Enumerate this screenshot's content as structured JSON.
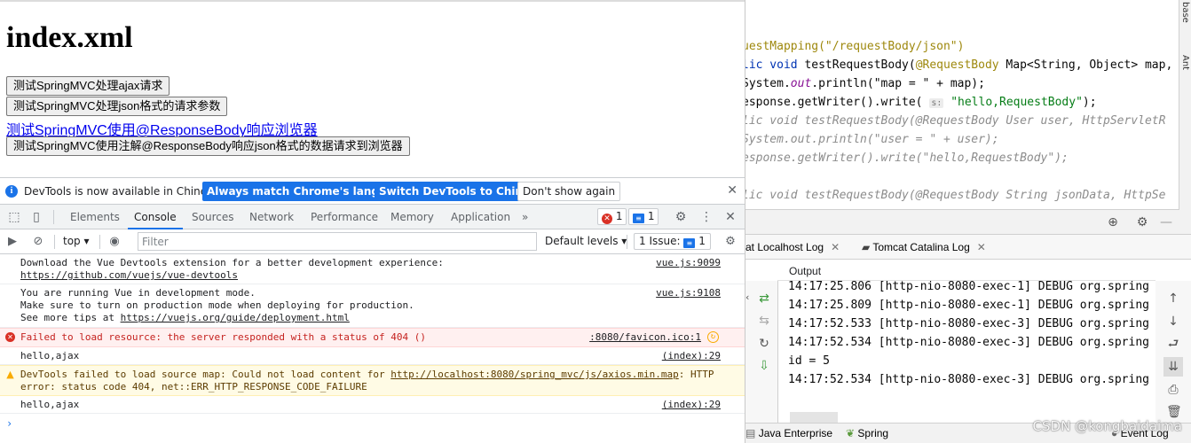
{
  "page": {
    "title": "index.xml",
    "btn_ajax": "测试SpringMVC处理ajax请求",
    "btn_json": "测试SpringMVC处理json格式的请求参数",
    "link_responsebody": "测试SpringMVC使用@ResponseBody响应浏览器",
    "btn_responsebody_json": "测试SpringMVC使用注解@ResponseBody响应json格式的数据请求到浏览器"
  },
  "devtools": {
    "infobar": {
      "message": "DevTools is now available in Chinese!",
      "btn_match": "Always match Chrome's language",
      "btn_switch": "Switch DevTools to Chinese",
      "btn_dont_show": "Don't show again"
    },
    "tabs": [
      "Elements",
      "Console",
      "Sources",
      "Network",
      "Performance",
      "Memory",
      "Application"
    ],
    "active_tab": "Console",
    "error_count": "1",
    "message_count": "1",
    "context": "top",
    "filter_placeholder": "Filter",
    "levels": "Default levels",
    "issues": "1 Issue:",
    "issues_count": "1",
    "console": [
      {
        "type": "log",
        "text": "Download the Vue Devtools extension for a better development experience:",
        "link": "https://github.com/vuejs/vue-devtools",
        "src": "vue.js:9099"
      },
      {
        "type": "log",
        "line1": "You are running Vue in development mode.",
        "line2": "Make sure to turn on production mode when deploying for production.",
        "line3_prefix": "See more tips at ",
        "link": "https://vuejs.org/guide/deployment.html",
        "src": "vue.js:9108"
      },
      {
        "type": "error",
        "text": "Failed to load resource: the server responded with a status of 404 ()",
        "src": ":8080/favicon.ico:1"
      },
      {
        "type": "log",
        "text": "hello,ajax",
        "src": "(index):29"
      },
      {
        "type": "warning",
        "prefix": "DevTools failed to load source map: Could not load content for ",
        "link": "http://localhost:8080/spring_mvc/js/axios.min.map",
        "suffix": ": HTTP",
        "line2": "error: status code 404, net::ERR_HTTP_RESPONSE_CODE_FAILURE"
      },
      {
        "type": "log",
        "text": "hello,ajax",
        "src": "(index):29"
      }
    ]
  },
  "ide": {
    "code": {
      "l1": "uestMapping(\"/requestBody/json\")",
      "l2_kw": "lic void ",
      "l2_fn": "testRequestBody(",
      "l2_ann": "@RequestBody",
      "l2_rest": " Map<String, Object> map,",
      "l3_a": "System.",
      "l3_out": "out",
      "l3_b": ".println(\"map = \" + map);",
      "l4_a": "esponse.getWriter().write( ",
      "l4_hint": "s:",
      "l4_str": " \"hello,RequestBody\"",
      "l4_b": ");",
      "l5": "lic void testRequestBody(@RequestBody User user, HttpServletR",
      "l6": "System.out.println(\"user = \" + user);",
      "l7": "esponse.getWriter().write(\"hello,RequestBody\");",
      "l8": "lic void testRequestBody(@RequestBody String jsonData, HttpSe"
    },
    "side_labels": [
      "base",
      "Ant"
    ],
    "run_tabs": [
      "at Localhost Log",
      "Tomcat Catalina Log"
    ],
    "output_label": "Output",
    "log_lines": [
      "14:17:25.806 [http-nio-8080-exec-1] DEBUG org.spring",
      "14:17:25.809 [http-nio-8080-exec-1] DEBUG org.spring",
      "14:17:52.533 [http-nio-8080-exec-3] DEBUG org.spring",
      "14:17:52.534 [http-nio-8080-exec-3] DEBUG org.spring",
      "id = 5",
      "14:17:52.534 [http-nio-8080-exec-3] DEBUG org.spring"
    ],
    "status": {
      "java_enterprise": "Java Enterprise",
      "spring": "Spring",
      "event_log": "Event Log"
    },
    "watermark": "CSDN @kongbaidaima"
  }
}
